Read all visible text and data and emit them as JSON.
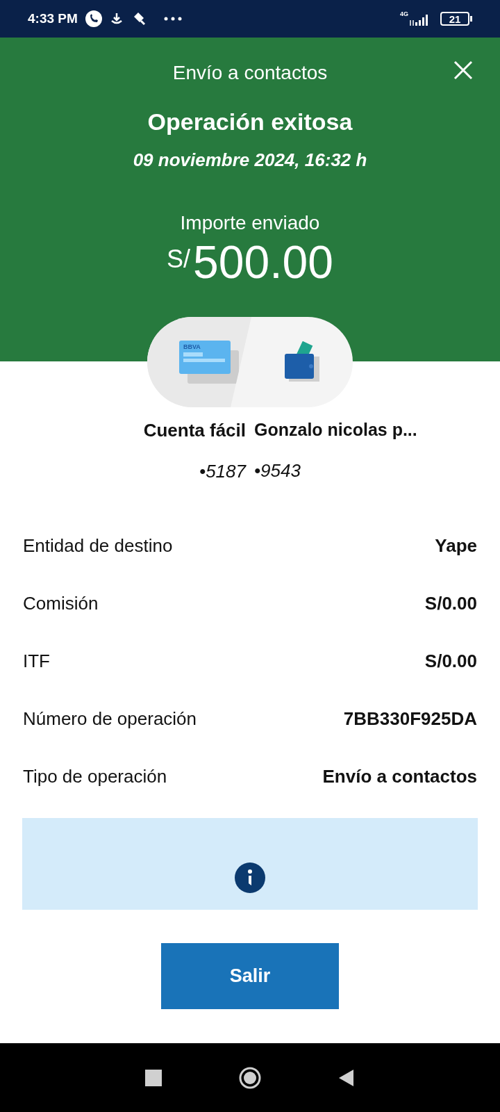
{
  "status_bar": {
    "time": "4:33 PM",
    "network": "4G",
    "battery": "21"
  },
  "header": {
    "title": "Envío a contactos",
    "status": "Operación exitosa",
    "datetime": "09 noviembre 2024, 16:32 h",
    "amount_label": "Importe enviado",
    "currency": "S/",
    "amount": "500.00"
  },
  "transfer": {
    "card_brand": "BBVA",
    "from": {
      "name": "Cuenta fácil",
      "number": "•5187"
    },
    "to": {
      "name": "Gonzalo nicolas p...",
      "number": "•9543"
    }
  },
  "details": [
    {
      "label": "Entidad de destino",
      "value": "Yape"
    },
    {
      "label": "Comisión",
      "value": "S/0.00"
    },
    {
      "label": "ITF",
      "value": "S/0.00"
    },
    {
      "label": "Número de operación",
      "value": "7BB330F925DA"
    },
    {
      "label": "Tipo de operación",
      "value": "Envío a contactos"
    }
  ],
  "button": "Salir"
}
